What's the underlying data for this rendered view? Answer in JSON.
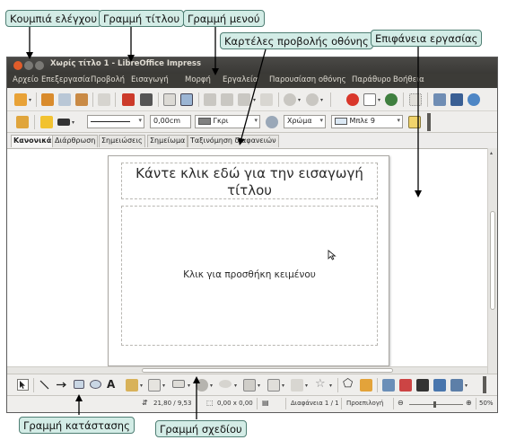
{
  "callouts": {
    "control_buttons": "Κουμπιά ελέγχου",
    "title_bar": "Γραμμή τίτλου",
    "menu_bar": "Γραμμή μενού",
    "view_tabs": "Καρτέλες προβολής οθόνης",
    "workspace": "Επιφάνεια εργασίας",
    "status_bar": "Γραμμή κατάστασης",
    "drawing_bar": "Γραμμή σχεδίου"
  },
  "window": {
    "title": "Χωρίς τίτλο 1 - LibreOffice Impress",
    "control_colors": [
      "#e05c2a",
      "#7a7975",
      "#7a7975"
    ]
  },
  "menu": [
    "Αρχείο",
    "Επεξεργασία",
    "Προβολή",
    "Εισαγωγή",
    "Μορφή",
    "Εργαλεία",
    "Παρουσίαση οθόνης",
    "Παράθυρο",
    "Βοήθεια"
  ],
  "toolbar2": {
    "line_width": "0,00cm",
    "line_color": "Γκρι",
    "area_style": "Χρώμα",
    "area_color": "Μπλε 9"
  },
  "tabs": [
    "Κανονικά",
    "Διάρθρωση",
    "Σημειώσεις",
    "Σημείωμα",
    "Ταξινόμηση διαφανειών"
  ],
  "slide": {
    "title_placeholder": "Κάντε κλικ εδώ για την εισαγωγή τίτλου",
    "content_placeholder": "Κλικ για προσθήκη κειμένου"
  },
  "status": {
    "position": "21,80 / 9,53",
    "size": "0,00 x 0,00",
    "slide": "Διαφάνεια 1 / 1",
    "layout": "Προεπιλογή",
    "zoom": "50%",
    "zoom_fraction": 0.45
  }
}
